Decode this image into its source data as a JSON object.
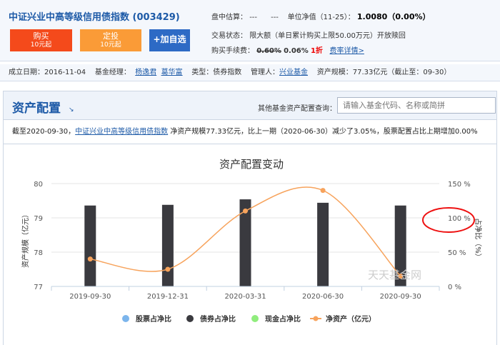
{
  "header": {
    "fund_name": "中证兴业中高等级信用债指数",
    "fund_code": "(003429)",
    "buy_label": "购买",
    "buy_sub": "10元起",
    "dt_label": "定投",
    "dt_sub": "10元起",
    "add_label": "+加自选",
    "estimate_label": "盘中估算：",
    "estimate_value": "---",
    "estimate_change": "---",
    "nav_label": "单位净值（11-25）：",
    "nav_value": "1.0080（0.00%）",
    "status_label": "交易状态：",
    "status_value": "限大额（单日累计购买上限50.00万元）开放赎回",
    "fee_label": "购买手续费：",
    "fee_original": "0.60%",
    "fee_current": "0.06%",
    "fee_discount": "1折",
    "fee_link": "费率详情>"
  },
  "meta": {
    "established_label": "成立日期：",
    "established": "2016-11-04",
    "manager_label": "基金经理：",
    "manager_1": "杨逸君",
    "manager_2": "葛华富",
    "type_label": "类型：",
    "type": "债券指数",
    "company_label": "管理人：",
    "company": "兴业基金",
    "scale_label": "资产规模：",
    "scale": "77.33亿元（截止至：09-30）"
  },
  "section": {
    "title": "资产配置",
    "arrow": "↘",
    "query_label": "其他基金资产配置查询：",
    "query_placeholder": "请输入基金代码、名称或简拼",
    "summary_prefix": "截至2020-09-30，",
    "summary_fund": "中证兴业中高等级信用债指数",
    "summary_rest": "净资产规模77.33亿元，比上一期（2020-06-30）减少了3.05%，股票配置占比上期增加0.00%"
  },
  "chart_data": {
    "type": "bar",
    "title": "资产配置变动",
    "categories": [
      "2019-09-30",
      "2019-12-31",
      "2020-03-31",
      "2020-06-30",
      "2020-09-30"
    ],
    "ylabel_left": "资产规模（亿元）",
    "ylabel_right": "占净比（%）",
    "ylim_left": [
      77,
      80
    ],
    "ylim_right": [
      0,
      150
    ],
    "left_ticks": [
      "77",
      "78",
      "79",
      "80"
    ],
    "right_ticks": [
      "0 %",
      "50 %",
      "100 %",
      "150 %"
    ],
    "series": [
      {
        "name": "股票占净比",
        "type": "bar",
        "axis": "right",
        "values": [
          0,
          0,
          0,
          0,
          0
        ],
        "color": "#7cb5ec"
      },
      {
        "name": "债券占净比",
        "type": "bar",
        "axis": "right",
        "values": [
          118,
          119,
          127,
          122,
          118
        ],
        "color": "#3a3a3f"
      },
      {
        "name": "现金占净比",
        "type": "bar",
        "axis": "right",
        "values": [
          0,
          0,
          0,
          0,
          0
        ],
        "color": "#90ed7d"
      },
      {
        "name": "净资产（亿元）",
        "type": "line",
        "axis": "left",
        "values": [
          77.8,
          77.5,
          79.2,
          79.8,
          77.3
        ],
        "color": "#f7a35c"
      }
    ],
    "watermark": "天天基金网",
    "highlight_color": "#e11"
  }
}
